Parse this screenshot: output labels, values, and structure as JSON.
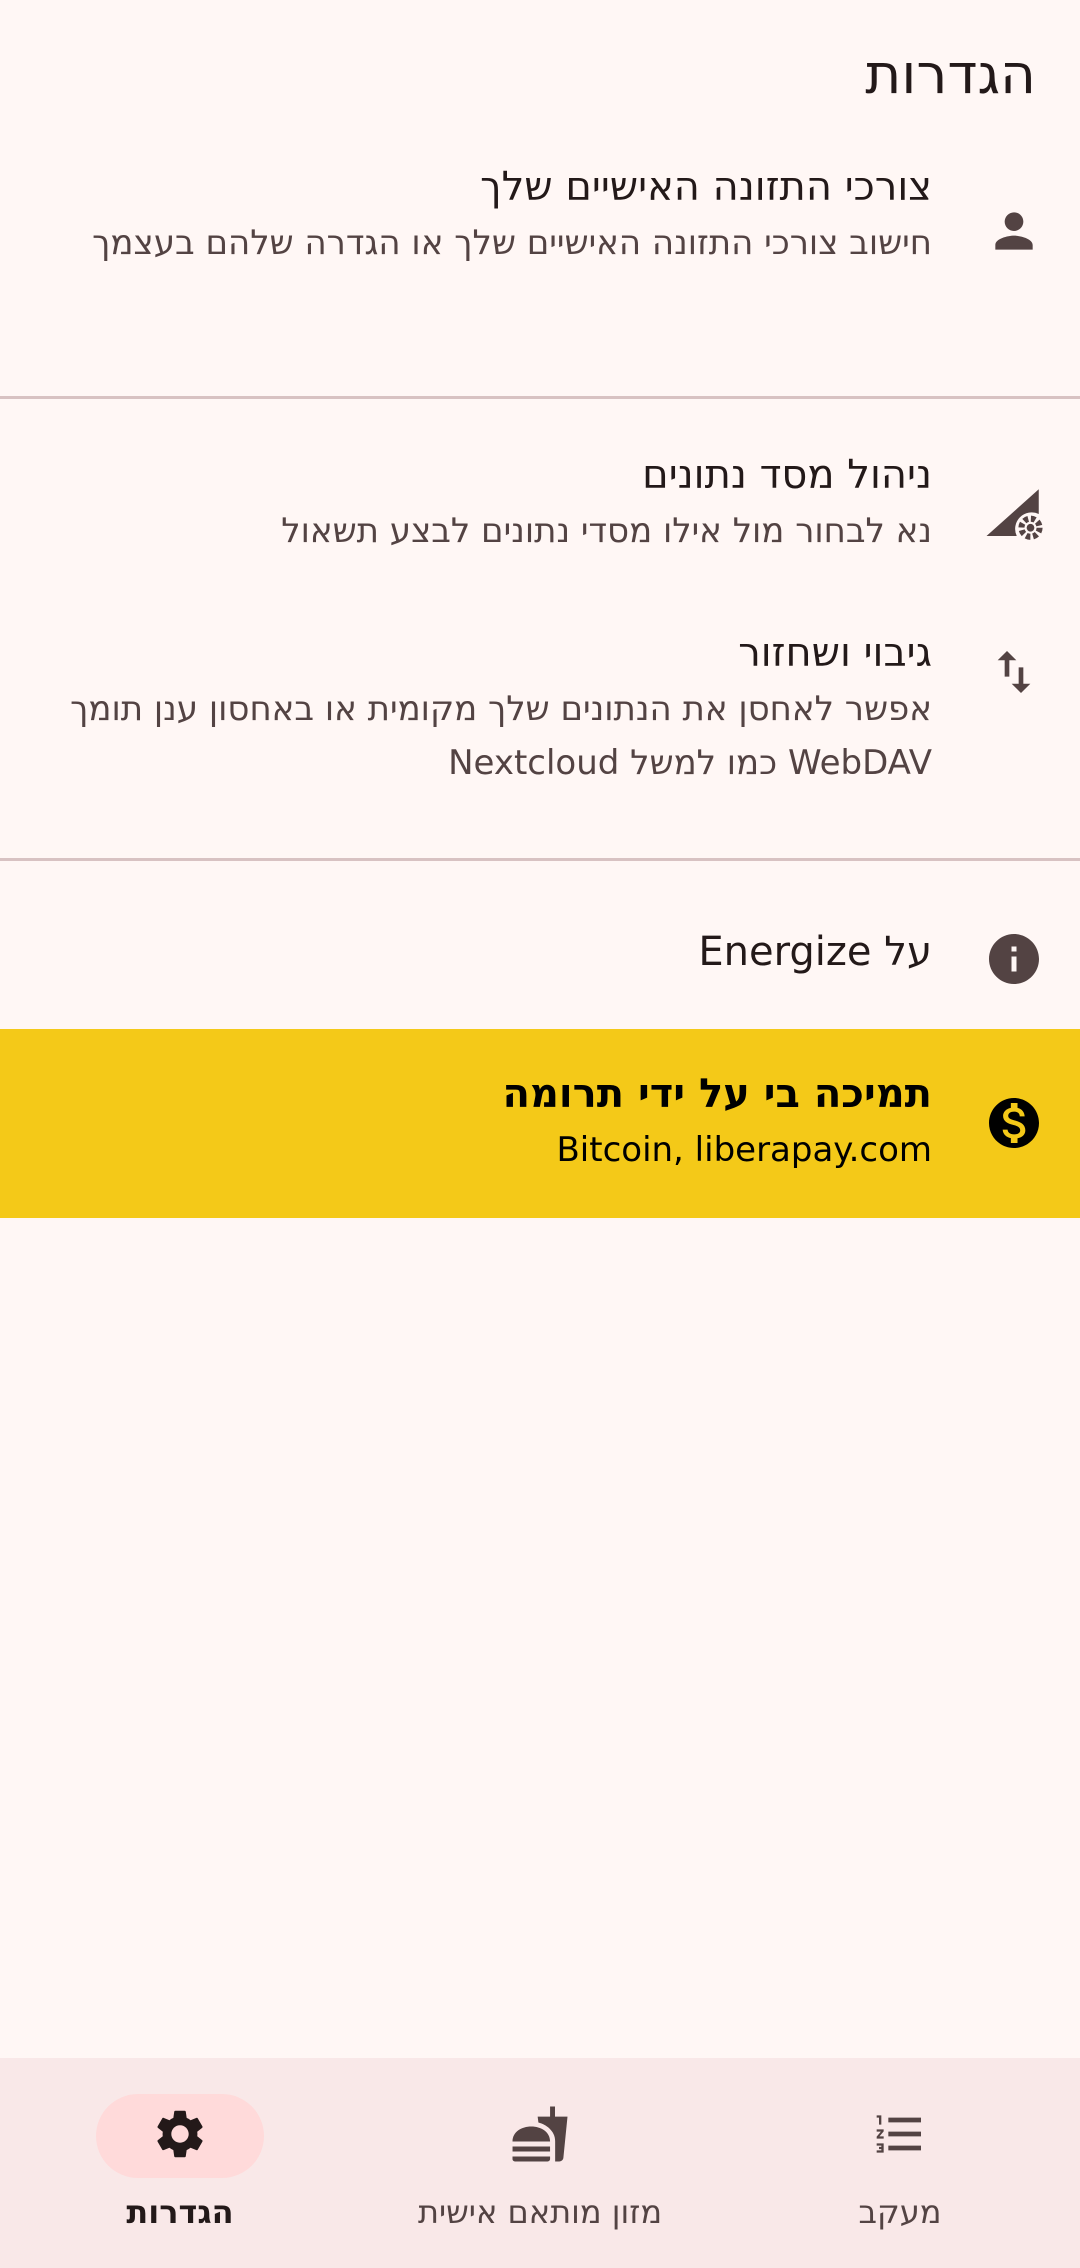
{
  "header": {
    "title": "הגדרות"
  },
  "settings": {
    "nutrition": {
      "title": "צורכי התזונה האישיים שלך",
      "subtitle": "חישוב צורכי התזונה האישיים שלך או הגדרה שלהם בעצמך",
      "icon": "person-icon"
    },
    "database": {
      "title": "ניהול מסד נתונים",
      "subtitle": "נא לבחור מול אילו מסדי נתונים לבצע תשאול",
      "icon": "database-settings-icon"
    },
    "backup": {
      "title": "גיבוי ושחזור",
      "subtitle": "אפשר לאחסן את הנתונים שלך מקומית או באחסון ענן תומך WebDAV כמו למשל Nextcloud",
      "icon": "swap-vertical-icon"
    },
    "about": {
      "title": "על Energize",
      "icon": "info-icon"
    },
    "donate": {
      "title": "תמיכה בי על ידי תרומה",
      "subtitle": "Bitcoin, liberapay.com",
      "icon": "dollar-icon",
      "color": "#f4c918"
    }
  },
  "bottom_nav": {
    "items": [
      {
        "label": "מעקב",
        "icon": "list-icon",
        "active": false
      },
      {
        "label": "מזון מותאם אישית",
        "icon": "fastfood-icon",
        "active": false
      },
      {
        "label": "הגדרות",
        "icon": "gear-icon",
        "active": true
      }
    ]
  },
  "colors": {
    "background": "#fff7f5",
    "accent_pill": "#ffdada",
    "donation_highlight": "#f4c918",
    "icon": "#534343"
  }
}
